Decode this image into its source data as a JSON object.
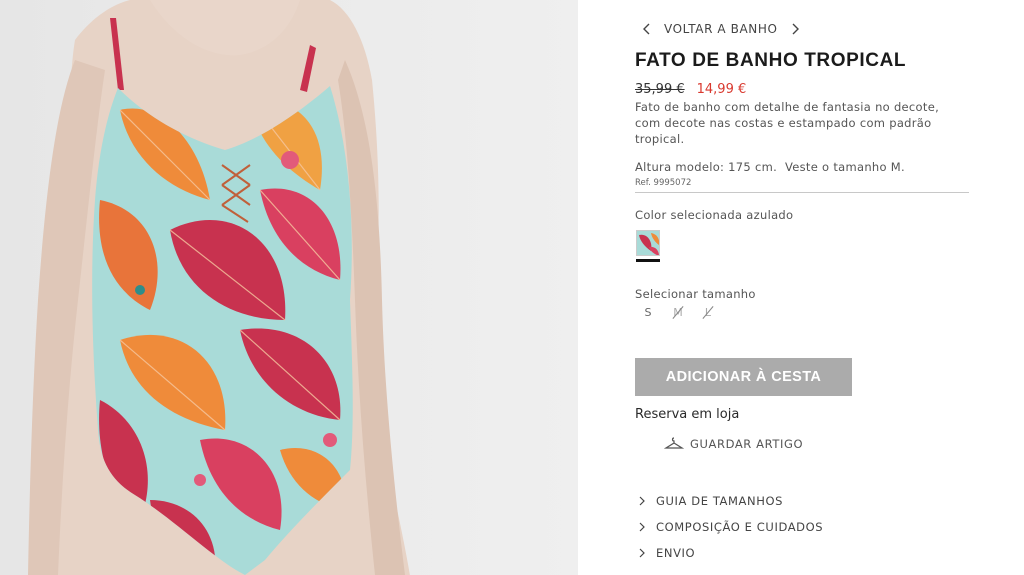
{
  "product_image": {
    "alt": ""
  },
  "breadcrumb": {
    "label": "VOLTAR A BANHO",
    "prev_icon": "chevron-left-icon",
    "next_icon": "chevron-right-icon"
  },
  "product": {
    "title": "FATO DE BANHO TROPICAL",
    "old_price": "35,99 €",
    "new_price": "14,99 €",
    "description": "Fato de banho com detalhe de fantasia no decote, com decote nas costas e estampado com padrão tropical.",
    "model_info": "Altura modelo: 175 cm.  Veste o tamanho M.",
    "ref": "Ref. 9995072"
  },
  "color": {
    "label": "Color selecionada azulado",
    "selected": "azulado"
  },
  "size": {
    "label": "Selecionar tamanho",
    "options": [
      {
        "label": "S",
        "available": true
      },
      {
        "label": "M",
        "available": false
      },
      {
        "label": "L",
        "available": false
      }
    ]
  },
  "actions": {
    "add_to_cart": "ADICIONAR À CESTA",
    "reserve": "Reserva em loja",
    "save": "GUARDAR ARTIGO",
    "save_icon": "hanger-icon"
  },
  "accordion": [
    {
      "label": "GUIA DE TAMANHOS"
    },
    {
      "label": "COMPOSIÇÃO E CUIDADOS"
    },
    {
      "label": "ENVIO"
    }
  ],
  "colors": {
    "sale_red": "#d9392f",
    "button_gray": "#ababab",
    "swimsuit_base": "#a9dbd8",
    "print_pink": "#c8324f",
    "print_orange": "#ef8b3a"
  }
}
